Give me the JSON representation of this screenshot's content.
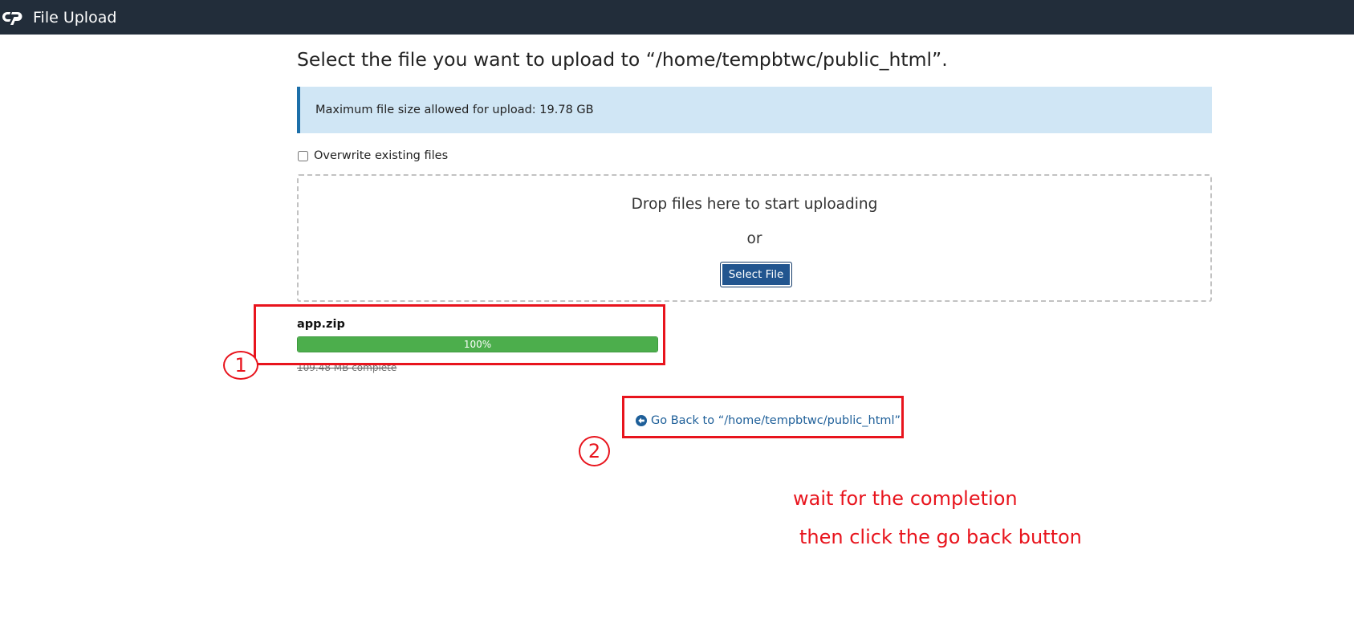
{
  "app": {
    "title": "File Upload",
    "logo_icon": "cpanel-logo-icon"
  },
  "main": {
    "heading": "Select the file you want to upload to “/home/tempbtwc/public_html”.",
    "info": "Maximum file size allowed for upload: 19.78 GB",
    "overwrite_label": "Overwrite existing files",
    "overwrite_checked": false,
    "dropzone": {
      "text": "Drop files here to start uploading",
      "or_text": "or",
      "button_label": "Select File"
    },
    "upload": {
      "file_name": "app.zip",
      "progress_percent": 100,
      "progress_label": "100%",
      "status": "109.48 MB complete"
    },
    "back_link": {
      "icon": "circle-arrow-left-icon",
      "label": "Go Back to “/home/tempbtwc/public_html”"
    }
  },
  "annotations": {
    "marker_1": "1",
    "marker_2": "2",
    "note_line_1": "wait for the completion",
    "note_line_2": "then click the go back button",
    "color": "#e8141d"
  },
  "colors": {
    "topbar": "#222d3a",
    "info_bg": "#d0e6f5",
    "info_border": "#1c6fa9",
    "button": "#22558f",
    "progress": "#4cae4c",
    "link": "#1e5f99"
  }
}
